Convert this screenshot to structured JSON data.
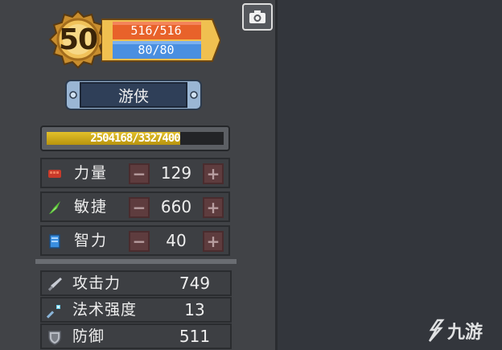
{
  "hud": {
    "level": "50",
    "hp": "516/516",
    "mp": "80/80",
    "class_name": "游侠",
    "xp": {
      "text": "2504168/3327400",
      "current": 2504168,
      "max": 3327400
    }
  },
  "attributes": [
    {
      "icon": "fist-icon",
      "label": "力量",
      "value": "129",
      "minus": "−",
      "plus": "+"
    },
    {
      "icon": "feather-icon",
      "label": "敏捷",
      "value": "660",
      "minus": "−",
      "plus": "+"
    },
    {
      "icon": "book-icon",
      "label": "智力",
      "value": "40",
      "minus": "−",
      "plus": "+"
    }
  ],
  "stats": [
    {
      "icon": "sword-icon",
      "label": "攻击力",
      "value": "749"
    },
    {
      "icon": "wand-icon",
      "label": "法术强度",
      "value": "13"
    },
    {
      "icon": "shield-icon",
      "label": "防御",
      "value": "511"
    }
  ],
  "watermark": {
    "text": "九游"
  },
  "colors": {
    "hp_bar": "#e8622a",
    "mp_bar": "#4a8fe0",
    "xp_fill": "#d9b21c",
    "badge_gold": "#e8b84a",
    "button_bg": "#5e3c3e"
  }
}
